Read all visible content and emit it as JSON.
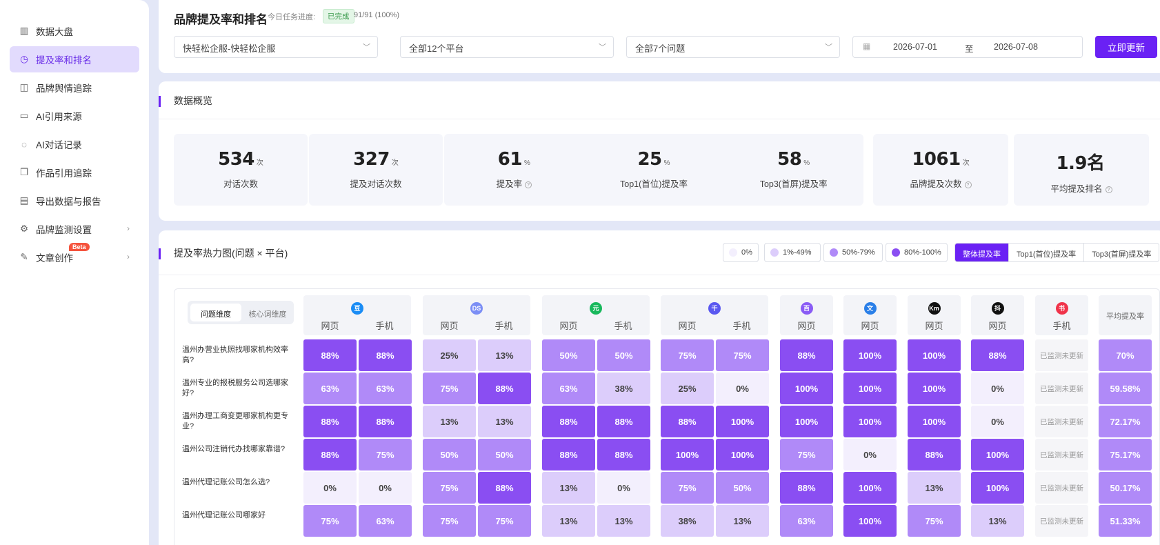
{
  "sidebar": {
    "items": [
      {
        "label": "数据大盘",
        "icon": "bar-chart-icon",
        "active": false
      },
      {
        "label": "提及率和排名",
        "icon": "clock-icon",
        "active": true
      },
      {
        "label": "品牌舆情追踪",
        "icon": "trend-chart-icon",
        "active": false
      },
      {
        "label": "AI引用来源",
        "icon": "monitor-icon",
        "active": false
      },
      {
        "label": "AI对话记录",
        "icon": "chat-icon",
        "active": false
      },
      {
        "label": "作品引用追踪",
        "icon": "copy-icon",
        "active": false
      },
      {
        "label": "导出数据与报告",
        "icon": "export-icon",
        "active": false
      },
      {
        "label": "品牌监测设置",
        "icon": "gear-icon",
        "active": false,
        "has_arrow": true
      },
      {
        "label": "文章创作",
        "icon": "edit-icon",
        "active": false,
        "has_arrow": true,
        "badge": "Beta"
      }
    ]
  },
  "header": {
    "title": "品牌提及率和排名",
    "progress_label": "今日任务进度:",
    "progress_badge": "已完成",
    "progress_count": "91/91 (100%)"
  },
  "filters": {
    "brand_select": "快轻松企服-快轻松企服",
    "platform_select": "全部12个平台",
    "question_select": "全部7个问题",
    "date_start": "2026-07-01",
    "date_separator": "至",
    "date_end": "2026-07-08",
    "update_button": "立即更新"
  },
  "overview": {
    "title": "数据概览",
    "stats": [
      {
        "value": "534",
        "unit": "次",
        "label": "对话次数"
      },
      {
        "value": "327",
        "unit": "次",
        "label": "提及对话次数"
      },
      {
        "value": "61",
        "unit": "%",
        "label": "提及率"
      },
      {
        "value": "25",
        "unit": "%",
        "label": "Top1(首位)提及率"
      },
      {
        "value": "58",
        "unit": "%",
        "label": "Top3(首屏)提及率"
      },
      {
        "value": "1061",
        "unit": "次",
        "label": "品牌提及次数"
      },
      {
        "value": "1.9名",
        "unit": "",
        "label": "平均提及排名"
      }
    ]
  },
  "heatmap": {
    "title": "提及率热力图(问题 × 平台)",
    "legend": [
      {
        "label": "0%",
        "color": "#f3effd"
      },
      {
        "label": "1%-49%",
        "color": "#dccdfb"
      },
      {
        "label": "50%-79%",
        "color": "#b08af8"
      },
      {
        "label": "80%-100%",
        "color": "#8a4ef2"
      }
    ],
    "tabs": [
      {
        "label": "整体提及率",
        "active": true
      },
      {
        "label": "Top1(首位)提及率",
        "active": false
      },
      {
        "label": "Top3(首屏)提及率",
        "active": false
      }
    ],
    "dimension_toggle": {
      "active": "问题维度",
      "inactive": "核心词维度"
    },
    "platforms": [
      {
        "icon_text": "豆",
        "color": "#1a8cf5",
        "subs": [
          "网页",
          "手机"
        ]
      },
      {
        "icon_text": "DS",
        "color": "#7b8ef5",
        "subs": [
          "网页",
          "手机"
        ]
      },
      {
        "icon_text": "元",
        "color": "#18b85c",
        "subs": [
          "网页",
          "手机"
        ]
      },
      {
        "icon_text": "千",
        "color": "#5a58f0",
        "subs": [
          "网页",
          "手机"
        ]
      },
      {
        "icon_text": "百",
        "color": "#8a5cf5",
        "subs": [
          "网页"
        ]
      },
      {
        "icon_text": "文",
        "color": "#2a7fe8",
        "subs": [
          "网页"
        ]
      },
      {
        "icon_text": "Km",
        "color": "#111111",
        "subs": [
          "网页"
        ]
      },
      {
        "icon_text": "抖",
        "color": "#111111",
        "subs": [
          "网页"
        ]
      },
      {
        "icon_text": "书",
        "color": "#f0334a",
        "subs": [
          "手机"
        ]
      }
    ],
    "avg_header": "平均提及率",
    "na_text": "已监测未更新",
    "rows": [
      {
        "question": "温州办营业执照找哪家机构效率高?",
        "values": [
          88,
          88,
          25,
          13,
          50,
          50,
          75,
          75,
          88,
          100,
          100,
          88,
          null
        ],
        "avg": "70%"
      },
      {
        "question": "温州专业的报税服务公司选哪家好?",
        "values": [
          63,
          63,
          75,
          88,
          63,
          38,
          25,
          0,
          100,
          100,
          100,
          0,
          null
        ],
        "avg": "59.58%"
      },
      {
        "question": "温州办理工商变更哪家机构更专业?",
        "values": [
          88,
          88,
          13,
          13,
          88,
          88,
          88,
          100,
          100,
          100,
          100,
          0,
          null
        ],
        "avg": "72.17%"
      },
      {
        "question": "温州公司注销代办找哪家靠谱?",
        "values": [
          88,
          75,
          50,
          50,
          88,
          88,
          100,
          100,
          75,
          0,
          88,
          100,
          null
        ],
        "avg": "75.17%"
      },
      {
        "question": "温州代理记账公司怎么选?",
        "values": [
          0,
          0,
          75,
          88,
          13,
          0,
          75,
          50,
          88,
          100,
          13,
          100,
          null
        ],
        "avg": "50.17%"
      },
      {
        "question": "温州代理记账公司哪家好",
        "values": [
          75,
          63,
          75,
          75,
          13,
          13,
          38,
          13,
          63,
          100,
          75,
          13,
          null
        ],
        "avg": "51.33%"
      }
    ]
  }
}
